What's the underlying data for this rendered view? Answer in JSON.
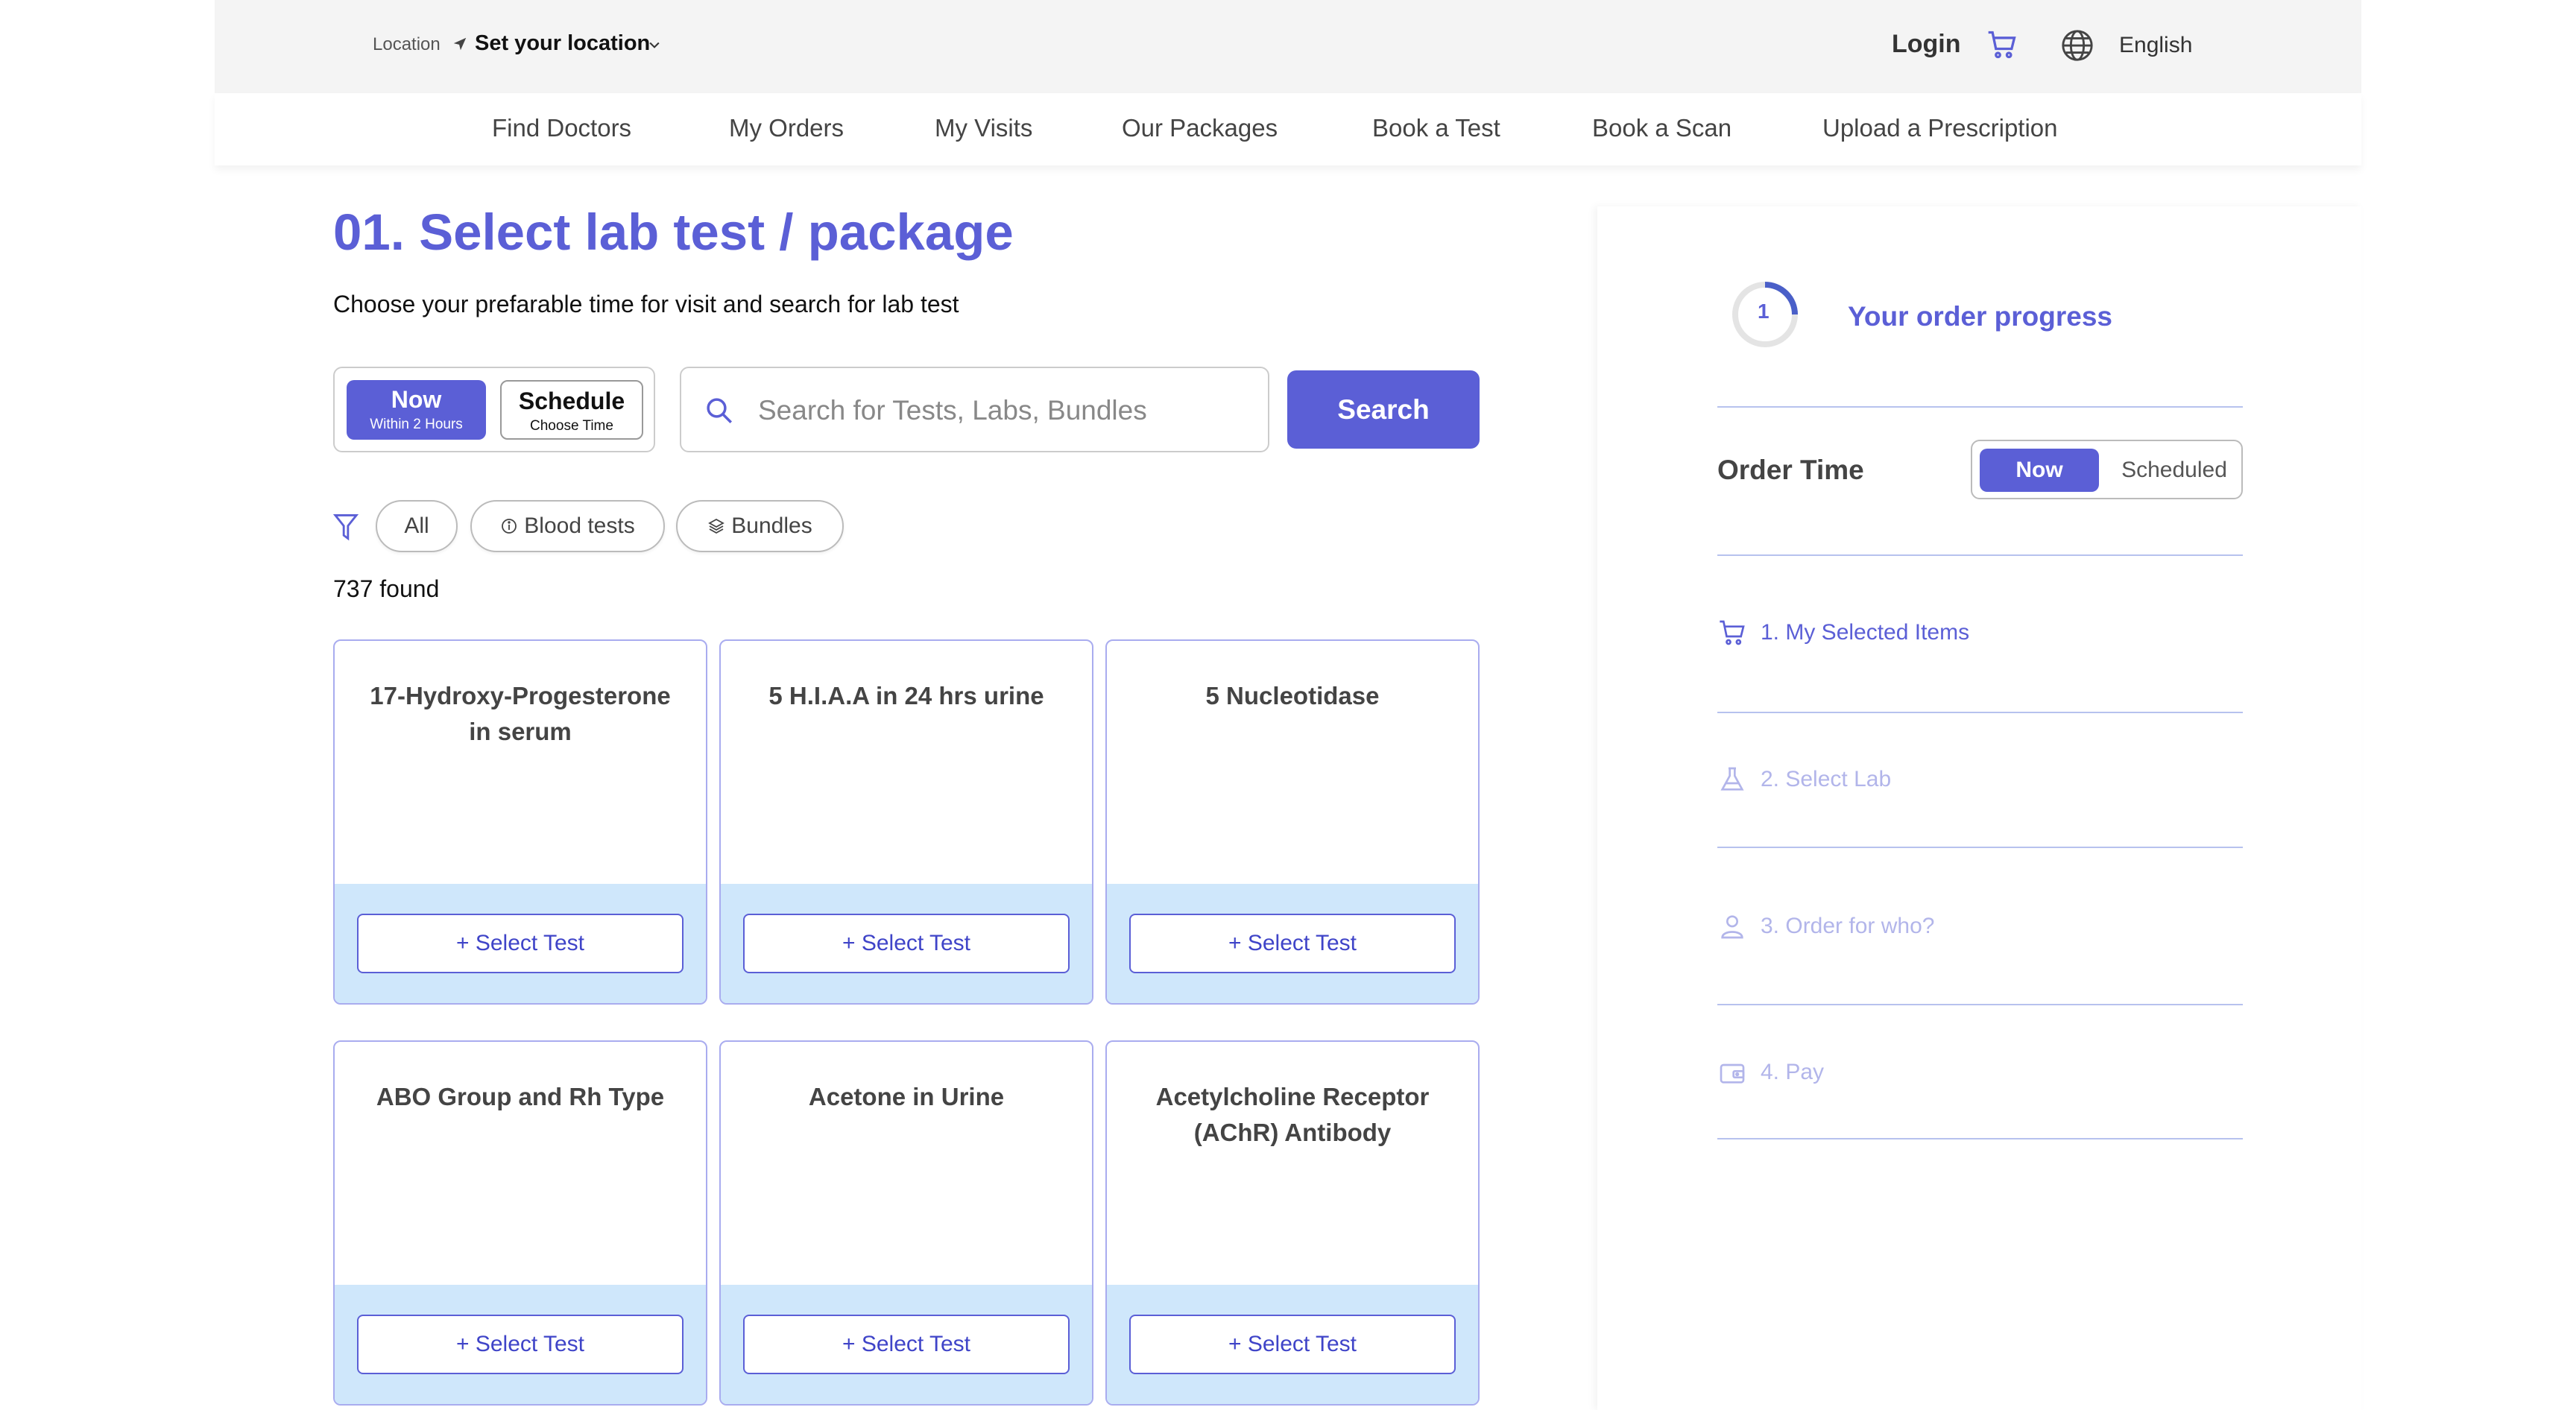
{
  "header": {
    "location_label": "Location",
    "location_value": "Set your location",
    "login_label": "Login",
    "language": "English"
  },
  "nav": {
    "items": [
      {
        "label": "Find Doctors"
      },
      {
        "label": "My Orders"
      },
      {
        "label": "My Visits"
      },
      {
        "label": "Our Packages"
      },
      {
        "label": "Book a Test"
      },
      {
        "label": "Book a Scan"
      },
      {
        "label": "Upload a Prescription"
      }
    ]
  },
  "main": {
    "title": "01. Select lab test / package",
    "subtitle": "Choose your prefarable time for visit and search for lab test",
    "toggle": {
      "now_label": "Now",
      "now_sub": "Within 2 Hours",
      "schedule_label": "Schedule",
      "schedule_sub": "Choose Time"
    },
    "search": {
      "placeholder": "Search for Tests, Labs, Bundles",
      "button_label": "Search"
    },
    "filters": [
      {
        "label": "All"
      },
      {
        "label": "Blood tests"
      },
      {
        "label": "Bundles"
      }
    ],
    "found_text": "737 found",
    "select_label": "Select Test",
    "cards": [
      {
        "name": "17-Hydroxy-Progesterone in serum"
      },
      {
        "name": "5 H.I.A.A in 24 hrs urine"
      },
      {
        "name": "5 Nucleotidase"
      },
      {
        "name": "ABO Group and Rh Type"
      },
      {
        "name": "Acetone in Urine"
      },
      {
        "name": "Acetylcholine Receptor (AChR) Antibody"
      }
    ]
  },
  "sidebar": {
    "progress_step": "1",
    "progress_title": "Your order progress",
    "order_time_label": "Order Time",
    "order_now": "Now",
    "order_scheduled": "Scheduled",
    "steps": [
      {
        "label": "1. My Selected Items",
        "icon": "cart-icon"
      },
      {
        "label": "2. Select Lab",
        "icon": "flask-icon"
      },
      {
        "label": "3. Order for who?",
        "icon": "user-icon"
      },
      {
        "label": "4. Pay",
        "icon": "wallet-icon"
      }
    ]
  },
  "colors": {
    "accent": "#5b5fd6",
    "card_footer": "#cfe7fb",
    "inactive_step": "#b2b5ea"
  }
}
